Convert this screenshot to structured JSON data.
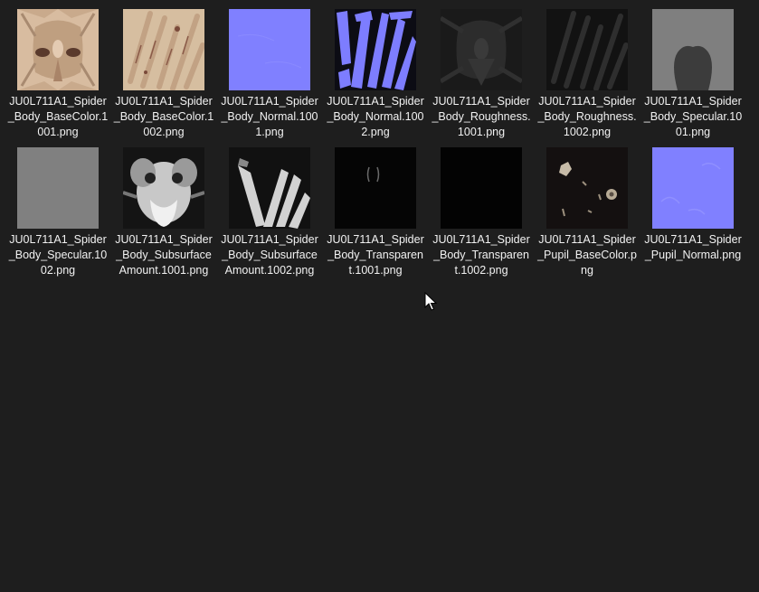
{
  "files": [
    {
      "name": "JU0L711A1_Spider_Body_BaseColor.1001.png",
      "preview": "basecolor-1001"
    },
    {
      "name": "JU0L711A1_Spider_Body_BaseColor.1002.png",
      "preview": "basecolor-1002"
    },
    {
      "name": "JU0L711A1_Spider_Body_Normal.1001.png",
      "preview": "normal-flat"
    },
    {
      "name": "JU0L711A1_Spider_Body_Normal.1002.png",
      "preview": "normal-1002"
    },
    {
      "name": "JU0L711A1_Spider_Body_Roughness.1001.png",
      "preview": "roughness-1001"
    },
    {
      "name": "JU0L711A1_Spider_Body_Roughness.1002.png",
      "preview": "roughness-1002"
    },
    {
      "name": "JU0L711A1_Spider_Body_Specular.1001.png",
      "preview": "specular-1001"
    },
    {
      "name": "JU0L711A1_Spider_Body_Specular.1002.png",
      "preview": "specular-1002"
    },
    {
      "name": "JU0L711A1_Spider_Body_SubsurfaceAmount.1001.png",
      "preview": "subsurface-1001"
    },
    {
      "name": "JU0L711A1_Spider_Body_SubsurfaceAmount.1002.png",
      "preview": "subsurface-1002"
    },
    {
      "name": "JU0L711A1_Spider_Body_Transparent.1001.png",
      "preview": "transparent-1001"
    },
    {
      "name": "JU0L711A1_Spider_Body_Transparent.1002.png",
      "preview": "transparent-1002"
    },
    {
      "name": "JU0L711A1_Spider_Pupil_BaseColor.png",
      "preview": "pupil-basecolor"
    },
    {
      "name": "JU0L711A1_Spider_Pupil_Normal.png",
      "preview": "pupil-normal"
    }
  ],
  "colors": {
    "background": "#1e1e1e",
    "label": "#f2f2f2",
    "normal_blue": "#7f7fff",
    "skin": "#c8a98a"
  },
  "cursor_icon": "arrow-cursor-icon"
}
